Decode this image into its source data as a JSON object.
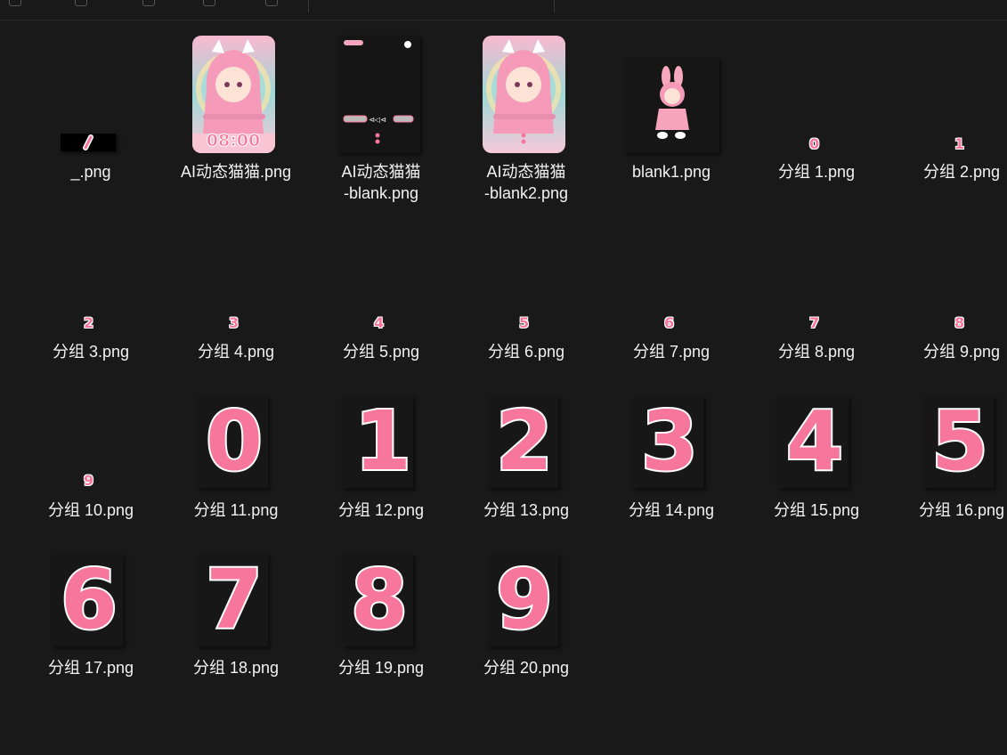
{
  "colors": {
    "background": "#191919",
    "digit_pink": "#f7769b",
    "digit_outline": "#ffffff"
  },
  "toolbar": {
    "icons": [
      "view-icon",
      "copy-icon",
      "info-icon",
      "pane-icon",
      "more-icon"
    ]
  },
  "files": [
    {
      "name": "_.png",
      "thumbnail": "slash-sprite"
    },
    {
      "name": "AI动态猫猫.png",
      "thumbnail": "cat-girl-wallpaper",
      "overlay_text": "08:00"
    },
    {
      "name": "AI动态猫猫\n-blank.png",
      "name_line1": "AI动态猫猫",
      "name_line2": "-blank.png",
      "thumbnail": "transparent-ui-overlay"
    },
    {
      "name": "AI动态猫猫\n-blank2.png",
      "name_line1": "AI动态猫猫",
      "name_line2": "-blank2.png",
      "thumbnail": "cat-girl-wallpaper"
    },
    {
      "name": "blank1.png",
      "thumbnail": "bunny-girl-sticker"
    },
    {
      "name": "分组 1.png",
      "digit": "0"
    },
    {
      "name": "分组 2.png",
      "digit": "1"
    },
    {
      "name": "分组 3.png",
      "digit": "2"
    },
    {
      "name": "分组 4.png",
      "digit": "3"
    },
    {
      "name": "分组 5.png",
      "digit": "4"
    },
    {
      "name": "分组 6.png",
      "digit": "5"
    },
    {
      "name": "分组 7.png",
      "digit": "6"
    },
    {
      "name": "分组 8.png",
      "digit": "7"
    },
    {
      "name": "分组 9.png",
      "digit": "8"
    },
    {
      "name": "分组 10.png",
      "digit": "9"
    },
    {
      "name": "分组 11.png",
      "digit": "0"
    },
    {
      "name": "分组 12.png",
      "digit": "1"
    },
    {
      "name": "分组 13.png",
      "digit": "2"
    },
    {
      "name": "分组 14.png",
      "digit": "3"
    },
    {
      "name": "分组 15.png",
      "digit": "4"
    },
    {
      "name": "分组 16.png",
      "digit": "5"
    },
    {
      "name": "分组 17.png",
      "digit": "6"
    },
    {
      "name": "分组 18.png",
      "digit": "7"
    },
    {
      "name": "分组 19.png",
      "digit": "8"
    },
    {
      "name": "分组 20.png",
      "digit": "9"
    }
  ]
}
